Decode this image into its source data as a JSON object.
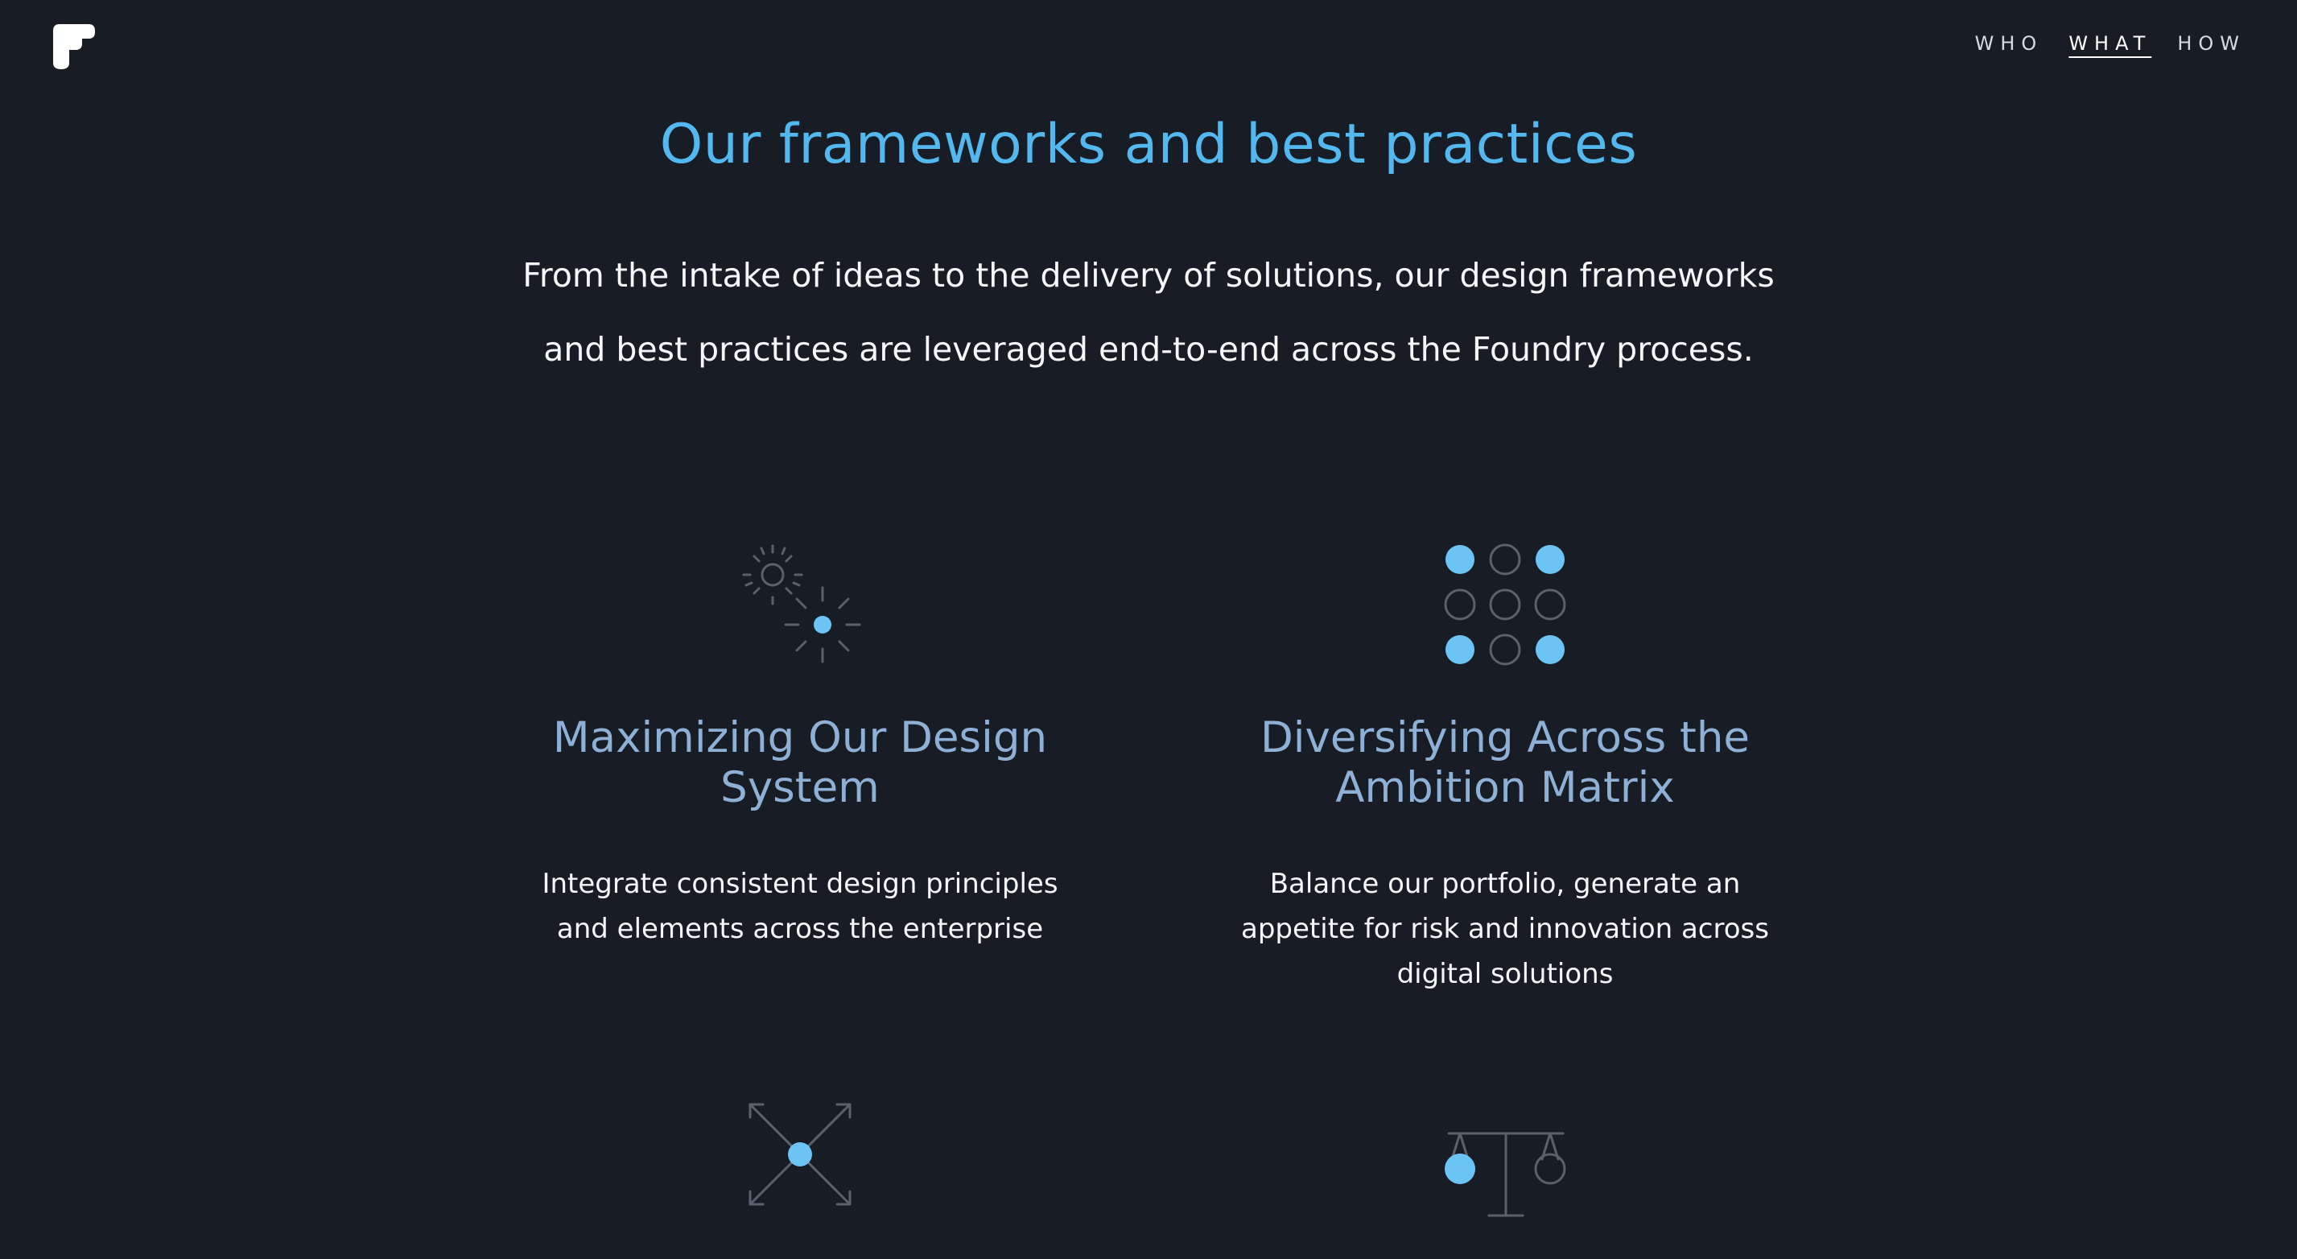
{
  "nav": {
    "items": [
      {
        "label": "WHO",
        "active": false
      },
      {
        "label": "WHAT",
        "active": true
      },
      {
        "label": "HOW",
        "active": false
      }
    ]
  },
  "header": {
    "title": "Our frameworks and best practices",
    "intro_line1": "From the intake of ideas to the delivery of solutions, our design frameworks",
    "intro_line2": "and best practices are leveraged end-to-end across the Foundry process."
  },
  "cards": [
    {
      "icon": "sparkle-icon",
      "title_line1": "Maximizing Our Design",
      "title_line2": "System",
      "desc_line1": "Integrate consistent design principles",
      "desc_line2": "and elements across the enterprise",
      "desc_line3": ""
    },
    {
      "icon": "dot-grid-icon",
      "title_line1": "Diversifying Across the",
      "title_line2": "Ambition Matrix",
      "desc_line1": "Balance our portfolio, generate an",
      "desc_line2": "appetite for risk and innovation across",
      "desc_line3": "digital solutions"
    },
    {
      "icon": "expand-arrows-icon"
    },
    {
      "icon": "balance-scale-icon"
    }
  ],
  "colors": {
    "background": "#181c24",
    "accent": "#52b8ef",
    "dot_fill": "#6cc4f5",
    "card_title": "#8fb0d6",
    "icon_stroke": "#5a616c"
  }
}
